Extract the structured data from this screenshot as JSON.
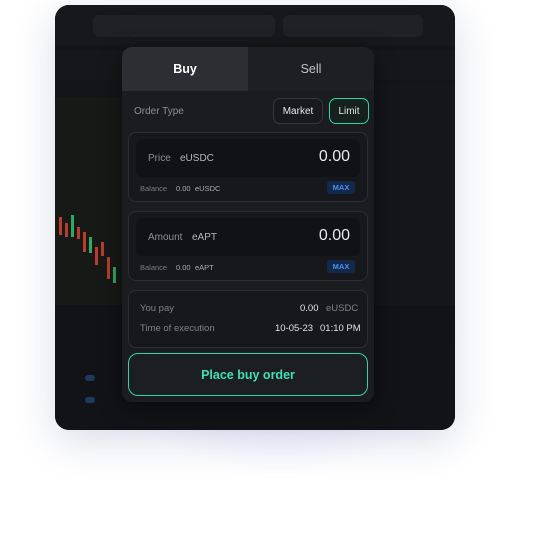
{
  "tabs": {
    "buy": "Buy",
    "sell": "Sell"
  },
  "order_type": {
    "label": "Order Type",
    "market": "Market",
    "limit": "Limit"
  },
  "price": {
    "label": "Price",
    "unit": "eUSDC",
    "value": "0.00",
    "balance_label": "Balance",
    "balance_value": "0.00",
    "balance_unit": "eUSDC",
    "max": "MAX"
  },
  "amount": {
    "label": "Amount",
    "unit": "eAPT",
    "value": "0.00",
    "balance_label": "Balance",
    "balance_value": "0.00",
    "balance_unit": "eAPT",
    "max": "MAX"
  },
  "summary": {
    "pay_label": "You pay",
    "pay_value": "0.00",
    "pay_unit": "eUSDC",
    "time_label": "Time of execution",
    "time_date": "10-05-23",
    "time_clock": "01:10 PM"
  },
  "place_button": "Place buy order",
  "colors": {
    "accent": "#2dd4a8",
    "max_text": "#4d8ff0"
  }
}
